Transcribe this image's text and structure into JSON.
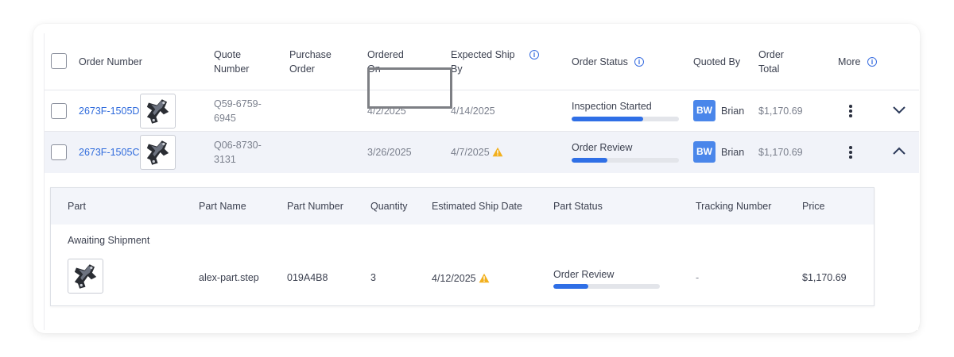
{
  "columns": {
    "order_number": "Order Number",
    "quote_number": "Quote Number",
    "purchase_order": "Purchase Order",
    "ordered_on": "Ordered On",
    "expected_ship_by": "Expected Ship By",
    "order_status": "Order Status",
    "quoted_by": "Quoted By",
    "order_total": "Order Total",
    "more": "More"
  },
  "orders": [
    {
      "order_number": "2673F-1505D",
      "quote_number": "Q59-6759-6945",
      "purchase_order": "",
      "ordered_on": "4/2/2025",
      "expected_ship_by": "4/14/2025",
      "ship_warning": false,
      "status": "Inspection Started",
      "status_progress": 0.67,
      "quoted_by_initials": "BW",
      "quoted_by_name": "Brian",
      "order_total": "$1,170.69",
      "expanded": false
    },
    {
      "order_number": "2673F-1505C",
      "quote_number": "Q06-8730-3131",
      "purchase_order": "",
      "ordered_on": "3/26/2025",
      "expected_ship_by": "4/7/2025",
      "ship_warning": true,
      "status": "Order Review",
      "status_progress": 0.33,
      "quoted_by_initials": "BW",
      "quoted_by_name": "Brian",
      "order_total": "$1,170.69",
      "expanded": true
    }
  ],
  "detail": {
    "columns": {
      "part": "Part",
      "part_name": "Part Name",
      "part_number": "Part Number",
      "quantity": "Quantity",
      "estimated_ship_date": "Estimated Ship Date",
      "part_status": "Part Status",
      "tracking_number": "Tracking Number",
      "price": "Price"
    },
    "group_label": "Awaiting Shipment",
    "part": {
      "part_name": "alex-part.step",
      "part_number": "019A4B8",
      "quantity": "3",
      "estimated_ship_date": "4/12/2025",
      "ship_warning": true,
      "part_status": "Order Review",
      "status_progress": 0.33,
      "tracking_number": "-",
      "price": "$1,170.69"
    }
  },
  "colors": {
    "link": "#2f6bdc",
    "progress": "#2f6fe6",
    "avatar": "#4a86ea",
    "warning": "#f2b01e",
    "highlight_border": "#7d7f84"
  }
}
